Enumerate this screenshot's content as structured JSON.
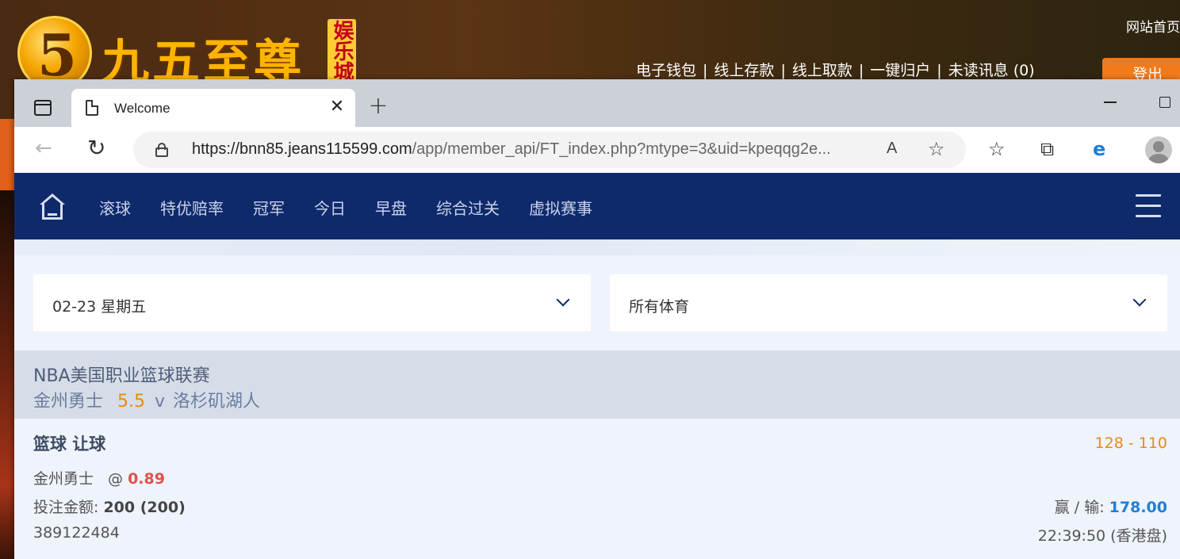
{
  "background_site": {
    "logo_digit": "5",
    "logo_text": "九五至尊",
    "logo_tag": "娱乐城",
    "home_link": "网站首页",
    "nav": [
      "电子钱包",
      "线上存款",
      "线上取款",
      "一键归户",
      "未读讯息 (0)"
    ],
    "nav_separator": "|",
    "login_button": "登出"
  },
  "browser": {
    "tab_title": "Welcome",
    "tab_close": "✕",
    "new_tab": "+",
    "url_host": "https://bnn85.jeans115599.com",
    "url_path": "/app/member_api/FT_index.php?mtype=3&uid=kpeqqg2e...",
    "read_aloud": "A",
    "back": "←",
    "refresh": "↻",
    "favorite_add": "☆",
    "favorites": "☆",
    "collections": "⧉",
    "ie_mode": "e"
  },
  "site_nav": {
    "items": [
      "滚球",
      "特优赔率",
      "冠军",
      "今日",
      "早盘",
      "综合过关",
      "虚拟赛事"
    ]
  },
  "filters": {
    "date": "02-23 星期五",
    "sport": "所有体育"
  },
  "match": {
    "league": "NBA美国职业篮球联赛",
    "home_team": "金州勇士",
    "handicap": "5.5",
    "vs": "v",
    "away_team": "洛杉矶湖人"
  },
  "bet": {
    "title": "篮球 让球",
    "score": "128 - 110",
    "pick_team": "金州勇士",
    "at_sign": "@",
    "odds": "0.89",
    "amount_label": "投注金额: ",
    "amount_value": "200 (200)",
    "win_label": "赢 / 输: ",
    "win_value": "178.00",
    "ticket_id": "389122484",
    "time": "22:39:50 (香港盘)"
  }
}
